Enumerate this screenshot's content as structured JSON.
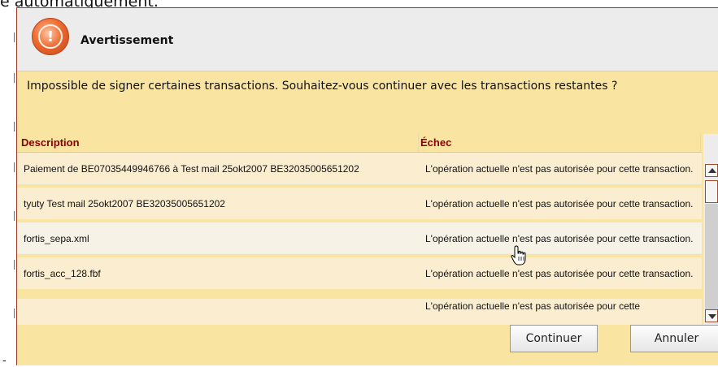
{
  "background_text": "e automatiquement.",
  "dialog": {
    "title": "Avertissement",
    "message": "Impossible de signer certaines transactions. Souhaitez-vous continuer avec les transactions restantes ?",
    "columns": [
      "Description",
      "Échec"
    ],
    "rows": [
      {
        "description": "Paiement de BE07035449946766 à Test mail 25okt2007 BE32035005651202",
        "error": "L'opération actuelle n'est pas autorisée pour cette transaction."
      },
      {
        "description": "tyuty Test mail 25okt2007 BE32035005651202",
        "error": "L'opération actuelle n'est pas autorisée pour cette transaction."
      },
      {
        "description": "fortis_sepa.xml",
        "error": "L'opération actuelle n'est pas autorisée pour cette transaction."
      },
      {
        "description": "fortis_acc_128.fbf",
        "error": "L'opération actuelle n'est pas autorisée pour cette transaction."
      },
      {
        "description": "",
        "error": "L'opération actuelle n'est pas autorisée pour cette"
      }
    ],
    "buttons": {
      "continue": "Continuer",
      "cancel": "Annuler"
    }
  },
  "colors": {
    "dialog_bg": "#f9e4a2",
    "header_text": "#8b0000",
    "titlebar": "#ececec",
    "border": "#9c3a22"
  },
  "icons": {
    "warning": "warning-icon",
    "cursor": "hand-pointer-icon"
  }
}
